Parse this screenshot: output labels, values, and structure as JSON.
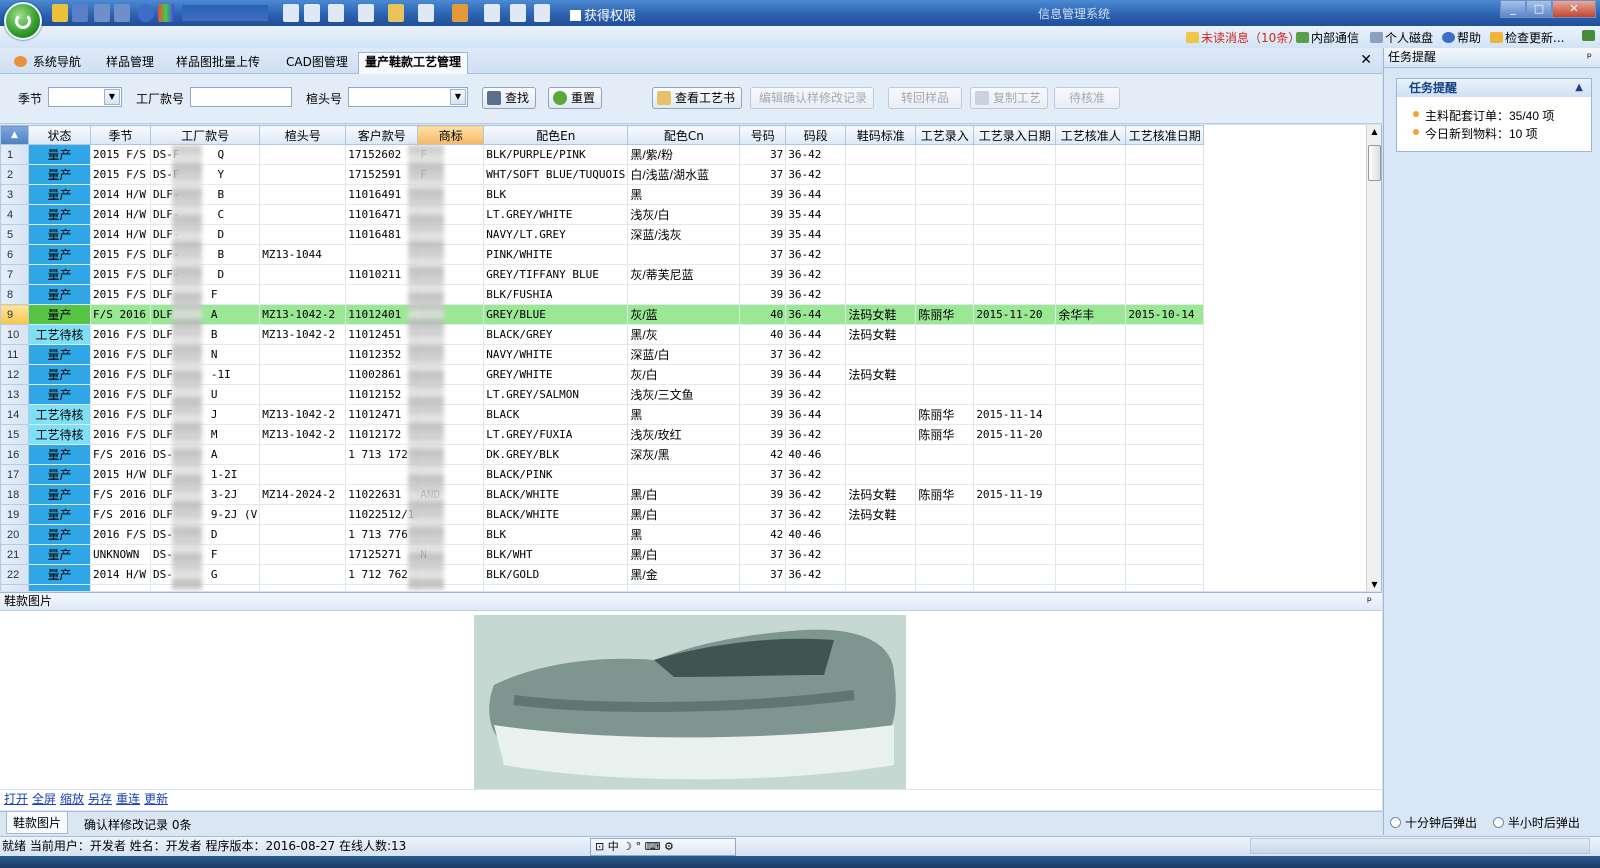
{
  "window": {
    "app_title": "信息管理系统",
    "permission_label": "获得权限"
  },
  "topmenu": {
    "unread": "未读消息（10条）",
    "internal": "内部通信",
    "disk": "个人磁盘",
    "help": "帮助",
    "update": "检查更新..."
  },
  "tabs": [
    "系统导航",
    "样品管理",
    "样品图批量上传",
    "CAD图管理",
    "量产鞋款工艺管理"
  ],
  "search": {
    "season_label": "季节",
    "factory_no_label": "工厂款号",
    "last_no_label": "楦头号",
    "find_btn": "查找",
    "reset_btn": "重置",
    "view_process_btn": "查看工艺书",
    "edit_confirm_btn": "编辑确认样修改记录",
    "return_sample_btn": "转回样品",
    "copy_process_btn": "复制工艺",
    "pending_btn": "待核准"
  },
  "grid": {
    "columns": [
      "状态",
      "季节",
      "工厂款号",
      "楦头号",
      "客户款号",
      "商标",
      "配色En",
      "配色Cn",
      "号码",
      "码段",
      "鞋码标准",
      "工艺录入",
      "工艺录入日期",
      "工艺核准人",
      "工艺核准日期"
    ],
    "selected_row": 9,
    "rows": [
      {
        "n": "1",
        "status": "量产",
        "st": "prod",
        "season": "2015 F/S",
        "factory": "DS-F",
        "factory2": "Q",
        "last": "",
        "cust": "17152602",
        "brand": "F",
        "en": "BLK/PURPLE/PINK",
        "cn": "黑/紫/粉",
        "size": "37",
        "range": "36-42",
        "std": "",
        "entry": "",
        "edate": "",
        "appr": "",
        "adate": ""
      },
      {
        "n": "2",
        "status": "量产",
        "st": "prod",
        "season": "2015 F/S",
        "factory": "DS-F",
        "factory2": "Y",
        "last": "",
        "cust": "17152591",
        "brand": "F",
        "en": "WHT/SOFT BLUE/TUQUOIS",
        "cn": "白/浅蓝/湖水蓝",
        "size": "37",
        "range": "36-42",
        "std": "",
        "entry": "",
        "edate": "",
        "appr": "",
        "adate": ""
      },
      {
        "n": "3",
        "status": "量产",
        "st": "prod",
        "season": "2014 H/W",
        "factory": "DLF-",
        "factory2": "B",
        "last": "",
        "cust": "11016491",
        "brand": "",
        "en": "BLK",
        "cn": "黑",
        "size": "39",
        "range": "36-44",
        "std": "",
        "entry": "",
        "edate": "",
        "appr": "",
        "adate": ""
      },
      {
        "n": "4",
        "status": "量产",
        "st": "prod",
        "season": "2014 H/W",
        "factory": "DLF-",
        "factory2": "C",
        "last": "",
        "cust": "11016471",
        "brand": "",
        "en": "LT.GREY/WHITE",
        "cn": "浅灰/白",
        "size": "39",
        "range": "35-44",
        "std": "",
        "entry": "",
        "edate": "",
        "appr": "",
        "adate": ""
      },
      {
        "n": "5",
        "status": "量产",
        "st": "prod",
        "season": "2014 H/W",
        "factory": "DLF-",
        "factory2": "D",
        "last": "",
        "cust": "11016481",
        "brand": "",
        "en": "NAVY/LT.GREY",
        "cn": "深蓝/浅灰",
        "size": "39",
        "range": "35-44",
        "std": "",
        "entry": "",
        "edate": "",
        "appr": "",
        "adate": ""
      },
      {
        "n": "6",
        "status": "量产",
        "st": "prod",
        "season": "2015 F/S",
        "factory": "DLF-",
        "factory2": "B",
        "last": "MZ13-1044",
        "cust": "",
        "brand": "",
        "en": "PINK/WHITE",
        "cn": "",
        "size": "37",
        "range": "36-42",
        "std": "",
        "entry": "",
        "edate": "",
        "appr": "",
        "adate": ""
      },
      {
        "n": "7",
        "status": "量产",
        "st": "prod",
        "season": "2015 F/S",
        "factory": "DLF-",
        "factory2": "D",
        "last": "",
        "cust": "11010211",
        "brand": "",
        "en": "GREY/TIFFANY BLUE",
        "cn": "灰/蒂芙尼蓝",
        "size": "39",
        "range": "36-42",
        "std": "",
        "entry": "",
        "edate": "",
        "appr": "",
        "adate": ""
      },
      {
        "n": "8",
        "status": "量产",
        "st": "prod",
        "season": "2015 F/S",
        "factory": "DLF",
        "factory2": "F",
        "last": "",
        "cust": "",
        "brand": "",
        "en": "BLK/FUSHIA",
        "cn": "",
        "size": "39",
        "range": "36-42",
        "std": "",
        "entry": "",
        "edate": "",
        "appr": "",
        "adate": ""
      },
      {
        "n": "9",
        "status": "量产",
        "st": "prod",
        "season": "F/S 2016",
        "factory": "DLF",
        "factory2": "A",
        "last": "MZ13-1042-2",
        "cust": "11012401",
        "brand": "",
        "en": "GREY/BLUE",
        "cn": "灰/蓝",
        "size": "40",
        "range": "36-44",
        "std": "法码女鞋",
        "entry": "陈丽华",
        "edate": "2015-11-20",
        "appr": "余华丰",
        "adate": "2015-10-14"
      },
      {
        "n": "10",
        "status": "工艺待核",
        "st": "pend",
        "season": "2016 F/S",
        "factory": "DLF",
        "factory2": "B",
        "last": "MZ13-1042-2",
        "cust": "11012451",
        "brand": "",
        "en": "BLACK/GREY",
        "cn": "黑/灰",
        "size": "40",
        "range": "36-44",
        "std": "法码女鞋",
        "entry": "",
        "edate": "",
        "appr": "",
        "adate": ""
      },
      {
        "n": "11",
        "status": "量产",
        "st": "prod",
        "season": "2016 F/S",
        "factory": "DLF",
        "factory2": "N",
        "last": "",
        "cust": "11012352",
        "brand": "",
        "en": "NAVY/WHITE",
        "cn": "深蓝/白",
        "size": "37",
        "range": "36-42",
        "std": "",
        "entry": "",
        "edate": "",
        "appr": "",
        "adate": ""
      },
      {
        "n": "12",
        "status": "量产",
        "st": "prod",
        "season": "2016 F/S",
        "factory": "DLF",
        "factory2": "-1I",
        "last": "",
        "cust": "11002861",
        "brand": "",
        "en": "GREY/WHITE",
        "cn": "灰/白",
        "size": "39",
        "range": "36-44",
        "std": "法码女鞋",
        "entry": "",
        "edate": "",
        "appr": "",
        "adate": ""
      },
      {
        "n": "13",
        "status": "量产",
        "st": "prod",
        "season": "2016 F/S",
        "factory": "DLF",
        "factory2": "U",
        "last": "",
        "cust": "11012152",
        "brand": "",
        "en": "LT.GREY/SALMON",
        "cn": "浅灰/三文鱼",
        "size": "39",
        "range": "36-42",
        "std": "",
        "entry": "",
        "edate": "",
        "appr": "",
        "adate": ""
      },
      {
        "n": "14",
        "status": "工艺待核",
        "st": "pend",
        "season": "2016 F/S",
        "factory": "DLF",
        "factory2": "J",
        "last": "MZ13-1042-2",
        "cust": "11012471",
        "brand": "",
        "en": "BLACK",
        "cn": "黑",
        "size": "39",
        "range": "36-44",
        "std": "",
        "entry": "陈丽华",
        "edate": "2015-11-14",
        "appr": "",
        "adate": ""
      },
      {
        "n": "15",
        "status": "工艺待核",
        "st": "pend",
        "season": "2016 F/S",
        "factory": "DLF",
        "factory2": "M",
        "last": "MZ13-1042-2",
        "cust": "11012172",
        "brand": "",
        "en": "LT.GREY/FUXIA",
        "cn": "浅灰/玫红",
        "size": "39",
        "range": "36-42",
        "std": "",
        "entry": "陈丽华",
        "edate": "2015-11-20",
        "appr": "",
        "adate": ""
      },
      {
        "n": "16",
        "status": "量产",
        "st": "prod",
        "season": "F/S 2016",
        "factory": "DS-",
        "factory2": "A",
        "last": "",
        "cust": "1 713 172",
        "brand": "",
        "en": "DK.GREY/BLK",
        "cn": "深灰/黑",
        "size": "42",
        "range": "40-46",
        "std": "",
        "entry": "",
        "edate": "",
        "appr": "",
        "adate": ""
      },
      {
        "n": "17",
        "status": "量产",
        "st": "prod",
        "season": "2015 H/W",
        "factory": "DLF",
        "factory2": "1-2I",
        "last": "",
        "cust": "",
        "brand": "",
        "en": "BLACK/PINK",
        "cn": "",
        "size": "37",
        "range": "36-42",
        "std": "",
        "entry": "",
        "edate": "",
        "appr": "",
        "adate": ""
      },
      {
        "n": "18",
        "status": "量产",
        "st": "prod",
        "season": "F/S 2016",
        "factory": "DLF",
        "factory2": "3-2J",
        "last": "MZ14-2024-2",
        "cust": "11022631",
        "brand": "AND",
        "en": "BLACK/WHITE",
        "cn": "黑/白",
        "size": "39",
        "range": "36-42",
        "std": "法码女鞋",
        "entry": "陈丽华",
        "edate": "2015-11-19",
        "appr": "",
        "adate": ""
      },
      {
        "n": "19",
        "status": "量产",
        "st": "prod",
        "season": "F/S 2016",
        "factory": "DLF",
        "factory2": "9-2J (V",
        "last": "",
        "cust": "11022512/1",
        "brand": "",
        "en": "BLACK/WHITE",
        "cn": "黑/白",
        "size": "37",
        "range": "36-42",
        "std": "法码女鞋",
        "entry": "",
        "edate": "",
        "appr": "",
        "adate": ""
      },
      {
        "n": "20",
        "status": "量产",
        "st": "prod",
        "season": "2016 F/S",
        "factory": "DS-",
        "factory2": "D",
        "last": "",
        "cust": "1 713 776",
        "brand": "",
        "en": "BLK",
        "cn": "黑",
        "size": "42",
        "range": "40-46",
        "std": "",
        "entry": "",
        "edate": "",
        "appr": "",
        "adate": ""
      },
      {
        "n": "21",
        "status": "量产",
        "st": "prod",
        "season": "UNKNOWN",
        "factory": "DS-",
        "factory2": "F",
        "last": "",
        "cust": "17125271",
        "brand": "N",
        "en": "BLK/WHT",
        "cn": "黑/白",
        "size": "37",
        "range": "36-42",
        "std": "",
        "entry": "",
        "edate": "",
        "appr": "",
        "adate": ""
      },
      {
        "n": "22",
        "status": "量产",
        "st": "prod",
        "season": "2014 H/W",
        "factory": "DS-",
        "factory2": "G",
        "last": "",
        "cust": "1 712 762",
        "brand": "",
        "en": "BLK/GOLD",
        "cn": "黑/金",
        "size": "37",
        "range": "36-42",
        "std": "",
        "entry": "",
        "edate": "",
        "appr": "",
        "adate": ""
      }
    ]
  },
  "image_panel": {
    "title": "鞋款图片",
    "links": [
      "打开",
      "全屏",
      "缩放",
      "另存",
      "重连",
      "更新"
    ]
  },
  "bottom_tabs": {
    "tab1": "鞋款图片",
    "tab2": "确认样修改记录 0条"
  },
  "right_panel": {
    "title": "任务提醒",
    "box_title": "任务提醒",
    "task1": "主料配套订单：35/40 项",
    "task2": "今日新到物料：10 项",
    "radio1": "十分钟后弹出",
    "radio2": "半小时后弹出"
  },
  "status": {
    "text": "就绪 当前用户：开发者 姓名：开发者 程序版本：2016-08-27 在线人数:13",
    "ime": "中"
  },
  "colors": {
    "status_production": "#2fa6e6",
    "status_pending": "#7edff7",
    "selected_row": "#9ae894",
    "title_bar": "#2a5fae"
  }
}
